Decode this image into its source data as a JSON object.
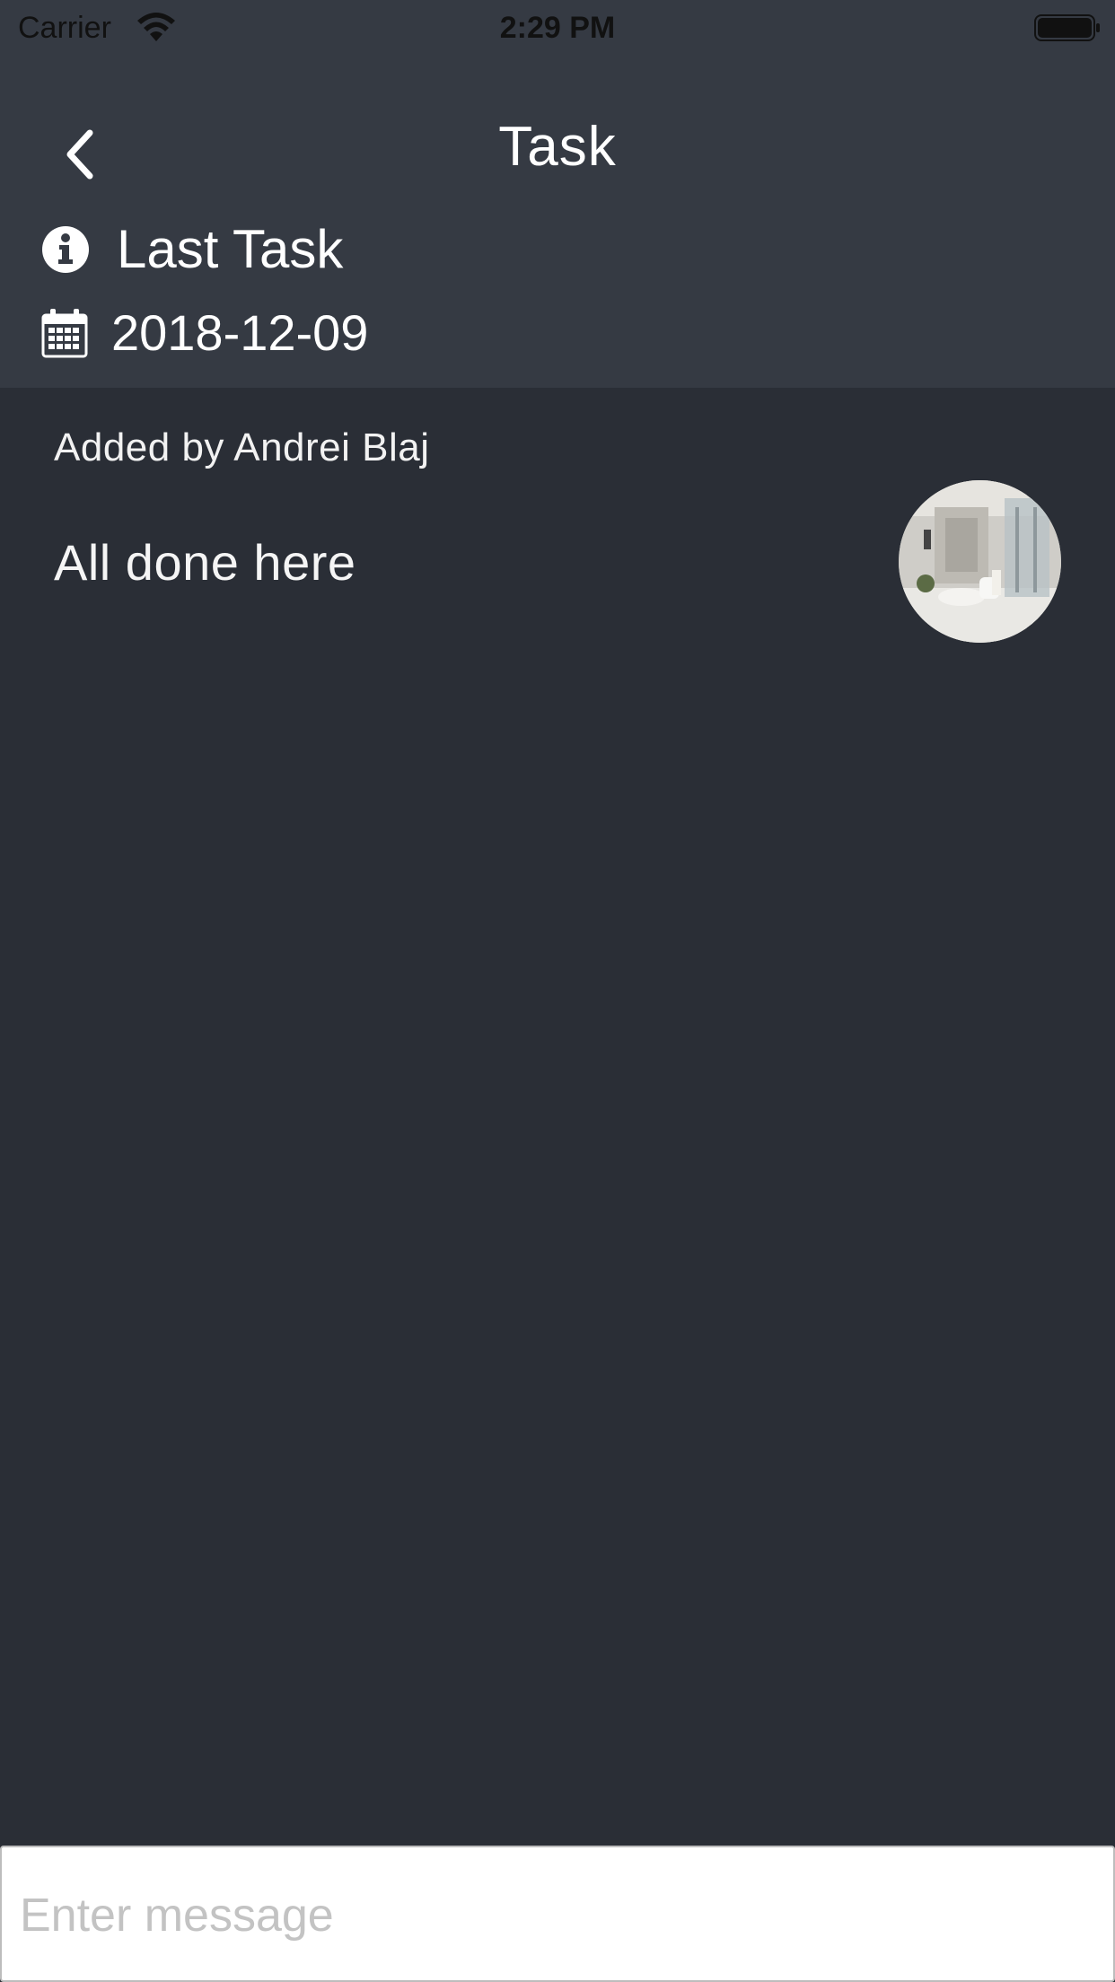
{
  "status_bar": {
    "carrier": "Carrier",
    "time": "2:29 PM",
    "wifi_icon": "wifi-icon",
    "battery_icon": "battery-icon"
  },
  "nav": {
    "title": "Task",
    "back_icon": "chevron-left-icon"
  },
  "task": {
    "name": "Last Task",
    "name_icon": "info-icon",
    "date": "2018-12-09",
    "date_icon": "calendar-icon"
  },
  "entry": {
    "added_by": "Added by Andrei Blaj",
    "message": "All done here",
    "photo_icon": "bathroom-photo-thumbnail"
  },
  "composer": {
    "placeholder": "Enter message",
    "value": ""
  },
  "colors": {
    "header_bg": "#353a43",
    "content_bg": "#2a2e36",
    "text": "#ffffff",
    "placeholder": "#c3c3c3"
  }
}
